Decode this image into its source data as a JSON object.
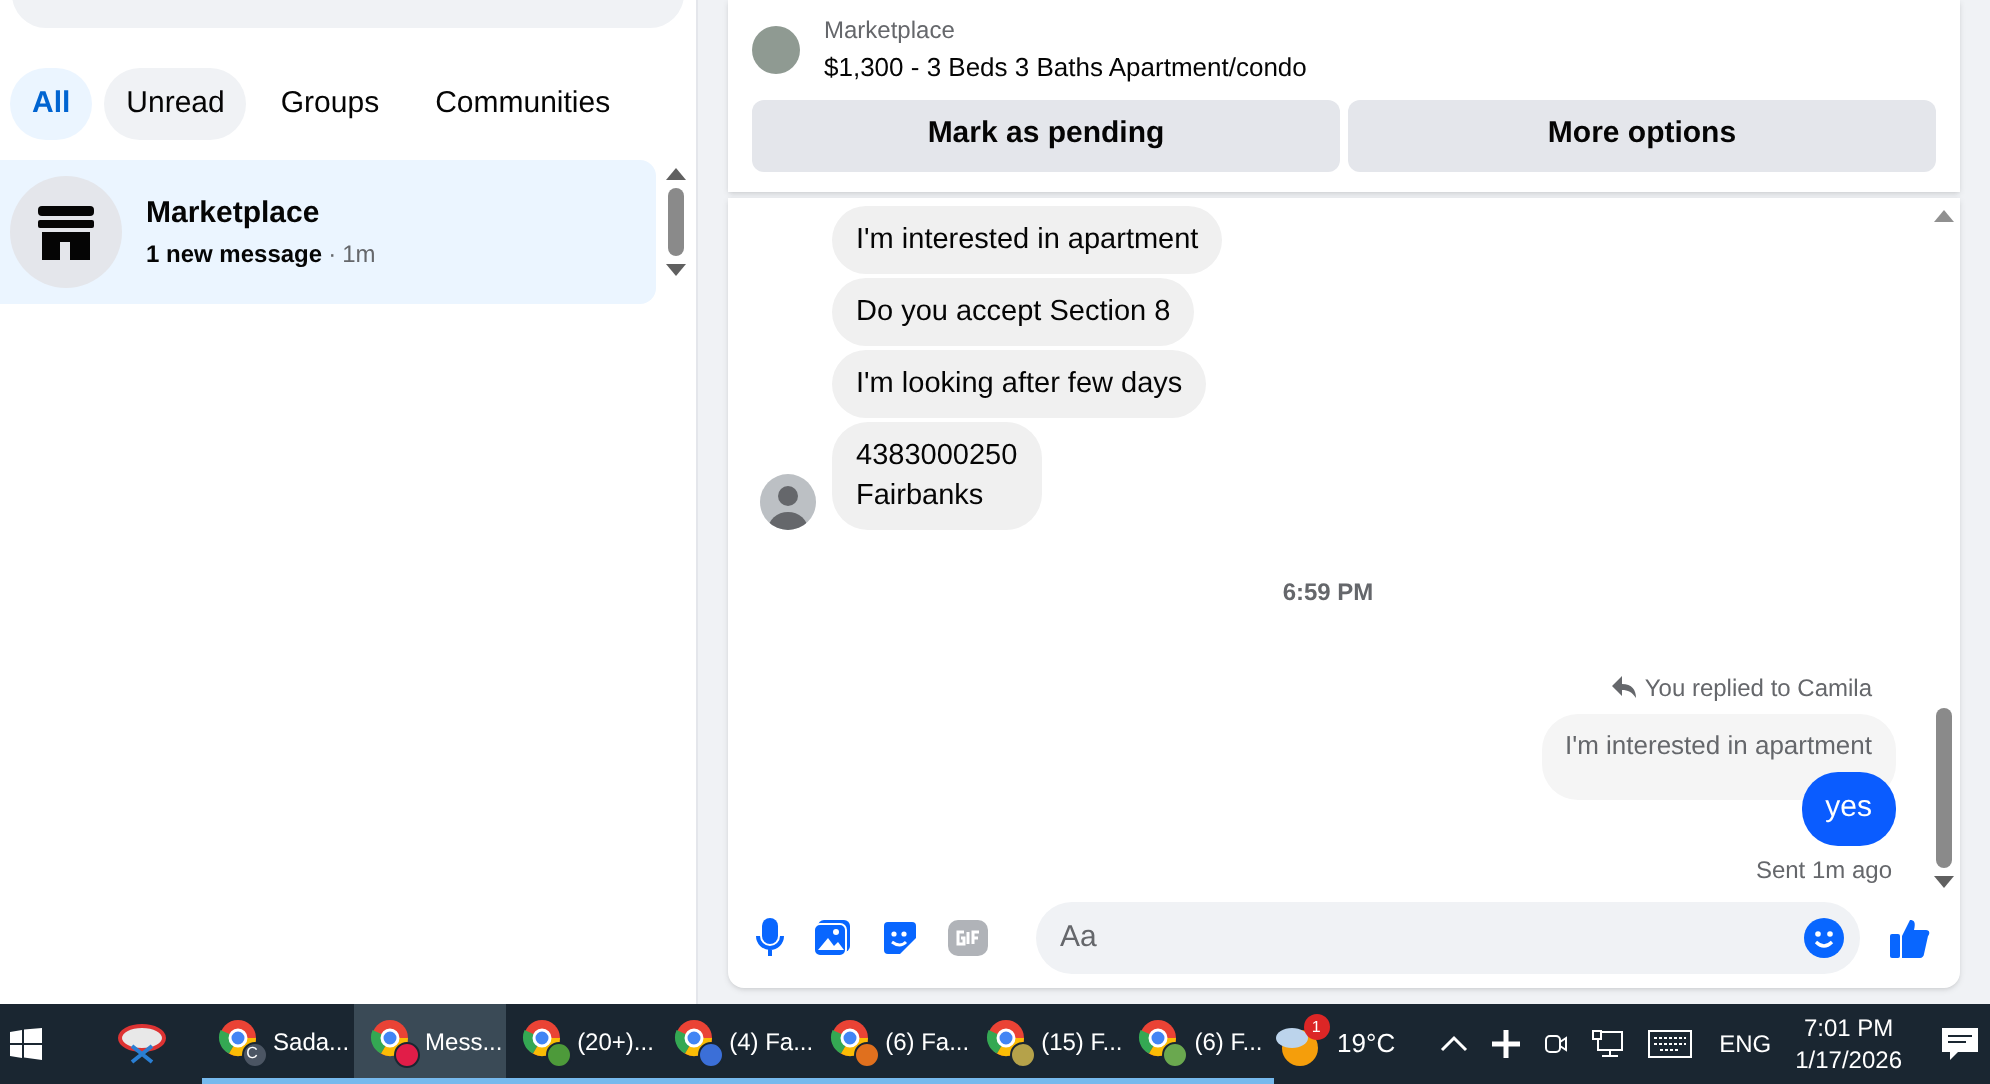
{
  "sidebar": {
    "filters": [
      {
        "label": "All",
        "selected": true
      },
      {
        "label": "Unread",
        "selected": false
      },
      {
        "label": "Groups",
        "selected": false
      },
      {
        "label": "Communities",
        "selected": false
      }
    ],
    "conversations": [
      {
        "name": "Marketplace",
        "preview": "1 new message",
        "separator": "·",
        "time": "1m",
        "unread": true,
        "selected": true
      }
    ]
  },
  "listing": {
    "source": "Marketplace",
    "title": "$1,300 - 3 Beds 3 Baths Apartment/condo",
    "buttons": [
      "Mark as pending",
      "More options"
    ]
  },
  "messages": [
    {
      "kind": "incoming",
      "lines": [
        "I'm interested in apartment"
      ]
    },
    {
      "kind": "incoming",
      "lines": [
        "Do you accept  Section 8"
      ]
    },
    {
      "kind": "incoming",
      "lines": [
        "I'm looking after few days"
      ]
    },
    {
      "kind": "incoming",
      "lines": [
        "4383000250",
        "Fairbanks"
      ],
      "avatar": true
    },
    {
      "kind": "time",
      "text": "6:59 PM"
    },
    {
      "kind": "reply_label",
      "text": "You replied to Camila"
    },
    {
      "kind": "quoted",
      "text": "I'm interested in apartment"
    },
    {
      "kind": "outgoing",
      "text": "yes"
    },
    {
      "kind": "status",
      "text": "Sent 1m ago"
    }
  ],
  "composer": {
    "placeholder": "Aa"
  },
  "taskbar": {
    "apps": [
      {
        "label": "Sada...",
        "badge": "C",
        "color": "#4b5563",
        "selected": false
      },
      {
        "label": "Mess...",
        "color": "#e11d48",
        "selected": true
      },
      {
        "label": "(20+)...",
        "color": "#4d9a3a",
        "selected": false
      },
      {
        "label": "(4) Fa...",
        "color": "#3b6fd8",
        "selected": false
      },
      {
        "label": "(6) Fa...",
        "color": "#e0701e",
        "selected": false
      },
      {
        "label": "(15) F...",
        "color": "#b5a24a",
        "selected": false
      },
      {
        "label": "(6) F...",
        "color": "#6aa84f",
        "selected": false
      }
    ],
    "weather_badge": "1",
    "temperature": "19°C",
    "language": "ENG",
    "time": "7:01 PM",
    "date": "1/17/2026"
  }
}
